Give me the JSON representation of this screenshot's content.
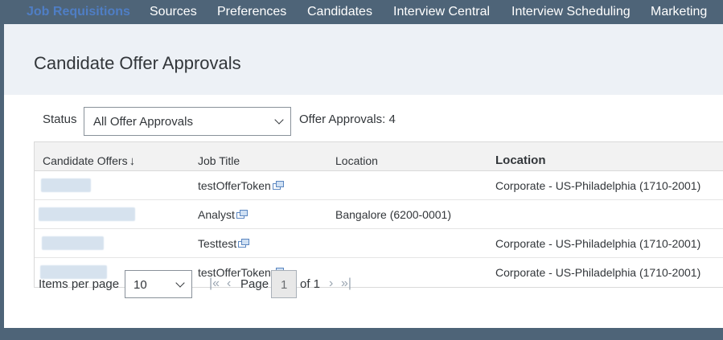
{
  "nav": {
    "items": [
      {
        "label": "Job Requisitions",
        "active": true
      },
      {
        "label": "Sources",
        "active": false
      },
      {
        "label": "Preferences",
        "active": false
      },
      {
        "label": "Candidates",
        "active": false
      },
      {
        "label": "Interview Central",
        "active": false
      },
      {
        "label": "Interview Scheduling",
        "active": false
      },
      {
        "label": "Marketing",
        "active": false
      }
    ]
  },
  "page": {
    "title": "Candidate Offer Approvals"
  },
  "filter": {
    "status_label": "Status",
    "status_value": "All Offer Approvals",
    "count_label": "Offer Approvals: 4"
  },
  "table": {
    "headers": {
      "candidate": "Candidate Offers",
      "job_title": "Job Title",
      "location": "Location",
      "location2": "Location"
    },
    "rows": [
      {
        "candidate": "",
        "job_title": "testOfferToken",
        "location": "",
        "location2": "Corporate - US-Philadelphia (1710-2001)"
      },
      {
        "candidate": "",
        "job_title": "Analyst",
        "location": "Bangalore (6200-0001)",
        "location2": ""
      },
      {
        "candidate": "",
        "job_title": "Testtest",
        "location": "",
        "location2": "Corporate - US-Philadelphia (1710-2001)"
      },
      {
        "candidate": "",
        "job_title": "testOfferToken",
        "location": "",
        "location2": "Corporate - US-Philadelphia (1710-2001)"
      }
    ]
  },
  "pager": {
    "items_per_page_label": "Items per page",
    "items_per_page_value": "10",
    "page_label": "Page",
    "current_page": "1",
    "of_label": "of 1"
  },
  "colors": {
    "nav_bg": "#4e6478",
    "nav_active": "#4f7ec5",
    "header_band": "#edf1f6",
    "link_icon": "#5a86c0"
  }
}
